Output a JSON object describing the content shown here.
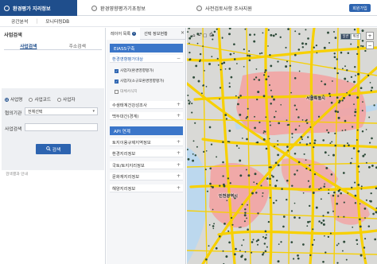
{
  "header": {
    "brand": "환경평가 지리정보",
    "menu": [
      {
        "label": "환경영향평가기초정보"
      },
      {
        "label": "사전검토사항 조사지원"
      }
    ],
    "login_label": "회원가입"
  },
  "subnav": {
    "items": [
      "공간분석",
      "모니터링DB"
    ]
  },
  "search_panel": {
    "title": "사업검색",
    "tabs": [
      "사업검색",
      "주소검색"
    ],
    "radios": [
      {
        "label": "사업명",
        "selected": true
      },
      {
        "label": "사업코드",
        "selected": false
      },
      {
        "label": "사업자",
        "selected": false
      }
    ],
    "agency_label": "협의기관",
    "agency_value": "전체선택",
    "keyword_label": "사업검색",
    "keyword_value": "",
    "search_button": "검색",
    "footer": "검색결과 안내"
  },
  "layer_panel": {
    "tabs": [
      {
        "label": "레이어 목록",
        "count": "1"
      },
      {
        "label": "선택 정보현황"
      }
    ],
    "groups": [
      {
        "label": "EIASS구축"
      },
      {
        "label": "API 연계"
      }
    ],
    "rows_top": [
      {
        "label": "환경영향평가대상",
        "highlight": true
      },
      {
        "label": "수생태계건강성조사",
        "highlight": false
      },
      {
        "label": "백두대간(경계)",
        "highlight": false
      }
    ],
    "checks": [
      {
        "label": "사업지(환경영향평가)",
        "checked": true
      },
      {
        "label": "사업지(소규모환경영향평가)",
        "checked": true
      },
      {
        "label": "대체서식지",
        "checked": false
      }
    ],
    "rows_api": [
      {
        "label": "토지이용규제지역정보"
      },
      {
        "label": "환경지리정보"
      },
      {
        "label": "국토/토지지리정보"
      },
      {
        "label": "문화재지리정보"
      },
      {
        "label": "해양지리정보"
      }
    ]
  },
  "map": {
    "map_types": [
      "일반",
      "위성"
    ],
    "active_map_type": "일반",
    "labels": [
      {
        "text": "서울특별시"
      },
      {
        "text": "인천광역시"
      }
    ],
    "colors": {
      "base": "#d9d9d6",
      "road": "#f7d000",
      "urban": "#f2a3a3",
      "water": "#bcd8ee",
      "point": "#2e4b3a"
    }
  }
}
